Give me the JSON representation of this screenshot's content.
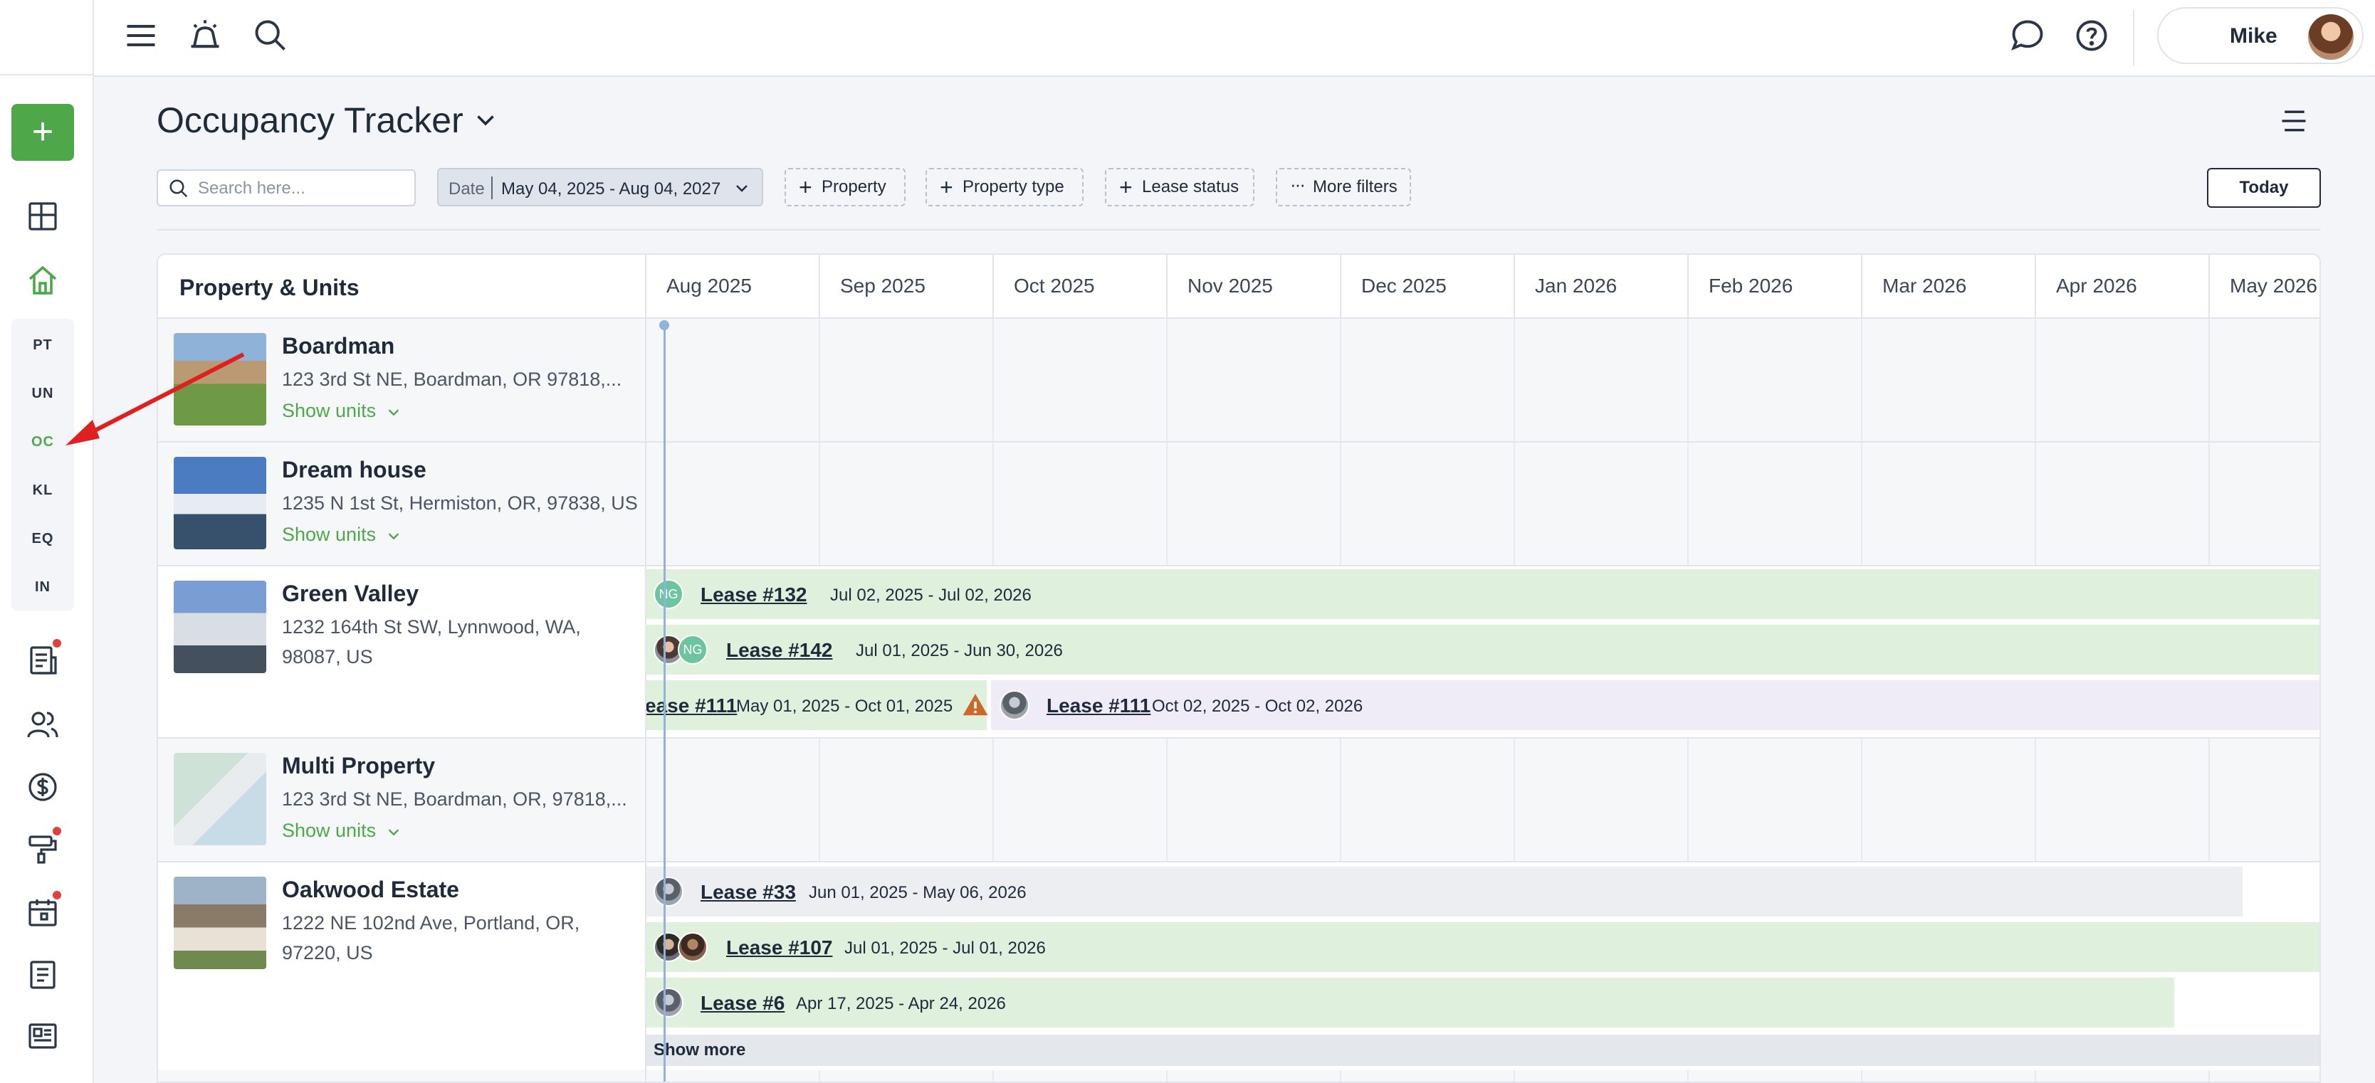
{
  "sidebar": {
    "add_label": "+",
    "abbrevs": [
      "PT",
      "UN",
      "OC",
      "KL",
      "EQ",
      "IN"
    ],
    "active_abbrev": "OC"
  },
  "topbar": {
    "user_name": "Mike"
  },
  "page": {
    "title": "Occupancy Tracker"
  },
  "filters": {
    "search_placeholder": "Search here...",
    "date_label": "Date",
    "date_value": "May 04, 2025 - Aug 04, 2027",
    "property": "Property",
    "property_type": "Property type",
    "lease_status": "Lease status",
    "more_filters": "More filters",
    "today": "Today"
  },
  "grid": {
    "left_header": "Property & Units",
    "months": [
      "Aug 2025",
      "Sep 2025",
      "Oct 2025",
      "Nov 2025",
      "Dec 2025",
      "Jan 2026",
      "Feb 2026",
      "Mar 2026",
      "Apr 2026",
      "May 2026"
    ],
    "show_more": "Show more"
  },
  "properties": [
    {
      "name": "Boardman",
      "address": "123 3rd St NE, Boardman, OR 97818,...",
      "show_units": "Show units"
    },
    {
      "name": "Dream house",
      "address": "1235 N 1st St, Hermiston, OR, 97838, US",
      "show_units": "Show units"
    },
    {
      "name": "Green Valley",
      "address_line1": "1232 164th St SW, Lynnwood, WA,",
      "address_line2": "98087, US"
    },
    {
      "name": "Multi Property",
      "address": "123 3rd St NE, Boardman, OR, 97818,...",
      "show_units": "Show units"
    },
    {
      "name": "Oakwood Estate",
      "address_line1": "1222 NE 102nd Ave, Portland, OR,",
      "address_line2": "97220, US"
    }
  ],
  "leases": {
    "gv": [
      {
        "label": "Lease #132",
        "dates": "Jul 02, 2025 - Jul 02, 2026",
        "initials": "NG"
      },
      {
        "label": "Lease #142",
        "dates": "Jul 01, 2025 - Jun 30, 2026",
        "initials": "NG"
      },
      {
        "label": "ease #111",
        "dates": "May 01, 2025 - Oct 01, 2025"
      },
      {
        "label": "Lease #111",
        "dates": "Oct 02, 2025 - Oct 02, 2026"
      }
    ],
    "oak": [
      {
        "label": "Lease #33",
        "dates": "Jun 01, 2025 - May 06, 2026"
      },
      {
        "label": "Lease #107",
        "dates": "Jul 01, 2025 - Jul 01, 2026"
      },
      {
        "label": "Lease #6",
        "dates": "Apr 17, 2025 - Apr 24, 2026"
      }
    ]
  },
  "colors": {
    "accent_green": "#4ea84a",
    "lease_green_bg": "#dff0dc",
    "lease_grey_bg": "#eceef2",
    "lease_purple_bg": "#efecf7",
    "warning": "#c96a2a",
    "annotation_arrow": "#e02020"
  }
}
